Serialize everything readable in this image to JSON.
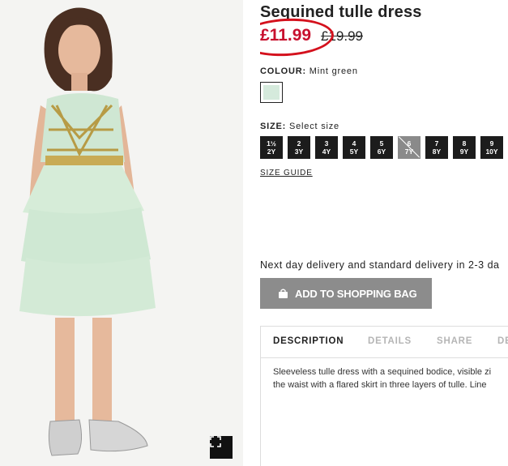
{
  "product": {
    "title": "Sequined tulle dress",
    "price_sale": "£11.99",
    "price_old": "£19.99"
  },
  "colour": {
    "label": "COLOUR:",
    "value": "Mint green",
    "swatch_color": "#d5eadc"
  },
  "size": {
    "label": "SIZE:",
    "hint": "Select size",
    "options": [
      {
        "line1": "1½",
        "line2": "2Y",
        "available": true
      },
      {
        "line1": "2",
        "line2": "3Y",
        "available": true
      },
      {
        "line1": "3",
        "line2": "4Y",
        "available": true
      },
      {
        "line1": "4",
        "line2": "5Y",
        "available": true
      },
      {
        "line1": "5",
        "line2": "6Y",
        "available": true
      },
      {
        "line1": "6",
        "line2": "7Y",
        "available": false
      },
      {
        "line1": "7",
        "line2": "8Y",
        "available": true
      },
      {
        "line1": "8",
        "line2": "9Y",
        "available": true
      },
      {
        "line1": "9",
        "line2": "10Y",
        "available": true
      }
    ],
    "guide": "SIZE GUIDE"
  },
  "delivery_text": "Next day delivery and standard delivery in 2-3 da",
  "add_to_bag": "ADD TO SHOPPING BAG",
  "tabs": [
    "DESCRIPTION",
    "DETAILS",
    "SHARE",
    "DE"
  ],
  "description": [
    "Sleeveless tulle dress with a sequined bodice, visible zi",
    "the waist with a flared skirt in three layers of tulle. Line"
  ],
  "colors": {
    "sale_red": "#c8102e",
    "highlight_circle": "#d4111d",
    "button_grey": "#8c8c8c",
    "size_chip": "#1c1c1c"
  },
  "icons": {
    "fullscreen": "expand-icon",
    "bag": "shopping-bag-icon"
  }
}
